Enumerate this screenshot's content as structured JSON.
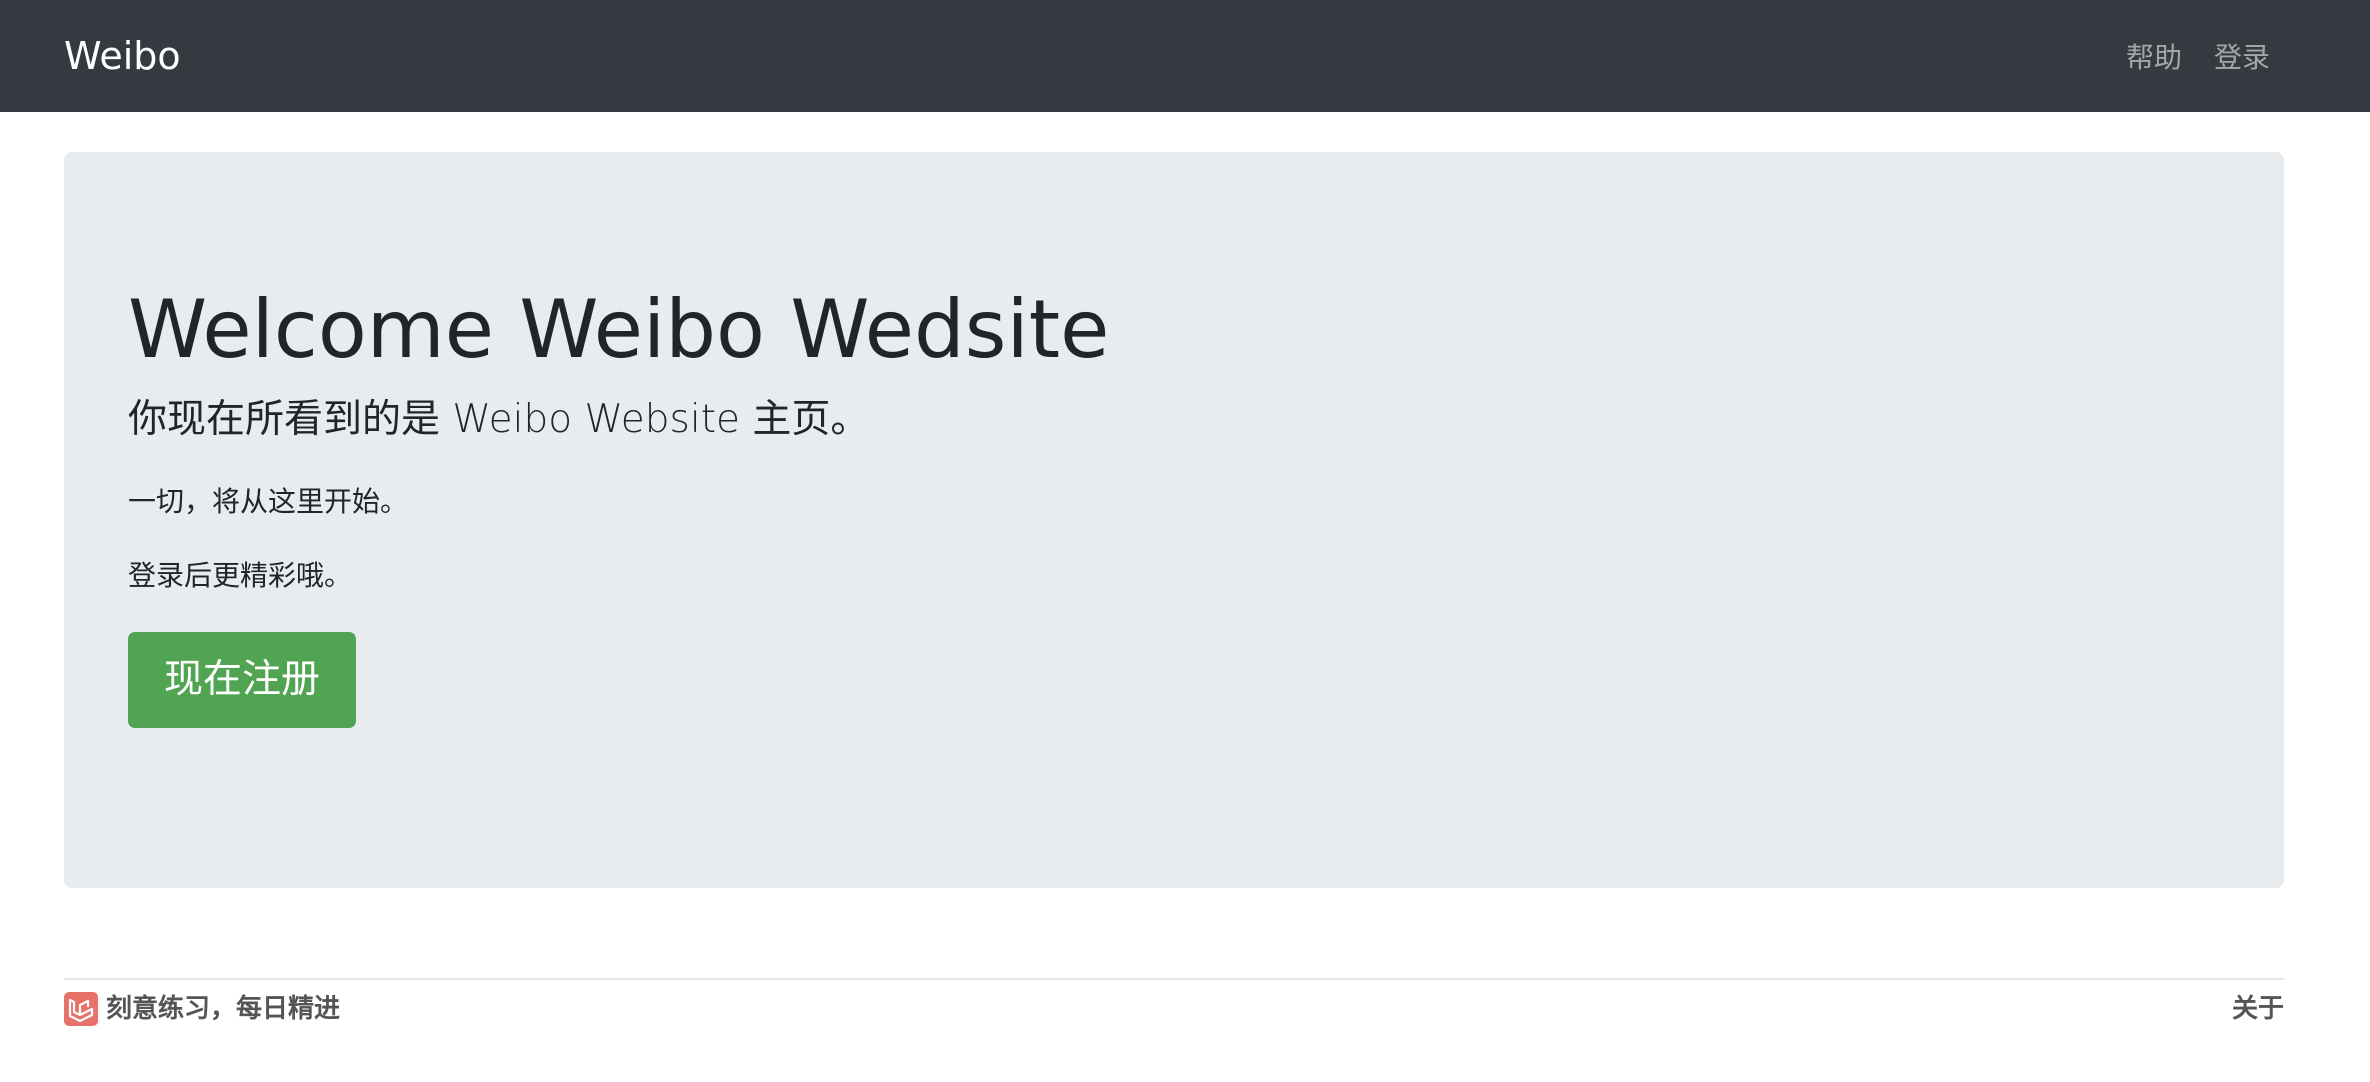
{
  "navbar": {
    "brand": "Weibo",
    "links": [
      "帮助",
      "登录"
    ]
  },
  "hero": {
    "title": "Welcome Weibo Wedsite",
    "lead": "你现在所看到的是 Weibo Website 主页。",
    "paragraphs": [
      "一切，将从这里开始。",
      "登录后更精彩哦。"
    ],
    "button_label": "现在注册"
  },
  "footer": {
    "left_text": "刻意练习，每日精进",
    "right_link": "关于"
  },
  "colors": {
    "navbar_bg": "#343a40",
    "jumbotron_bg": "#e9ecef",
    "button_bg": "#51a452",
    "logo_bg": "#e8726a"
  },
  "icons": {
    "footer_logo": "laravel-logo-icon"
  }
}
